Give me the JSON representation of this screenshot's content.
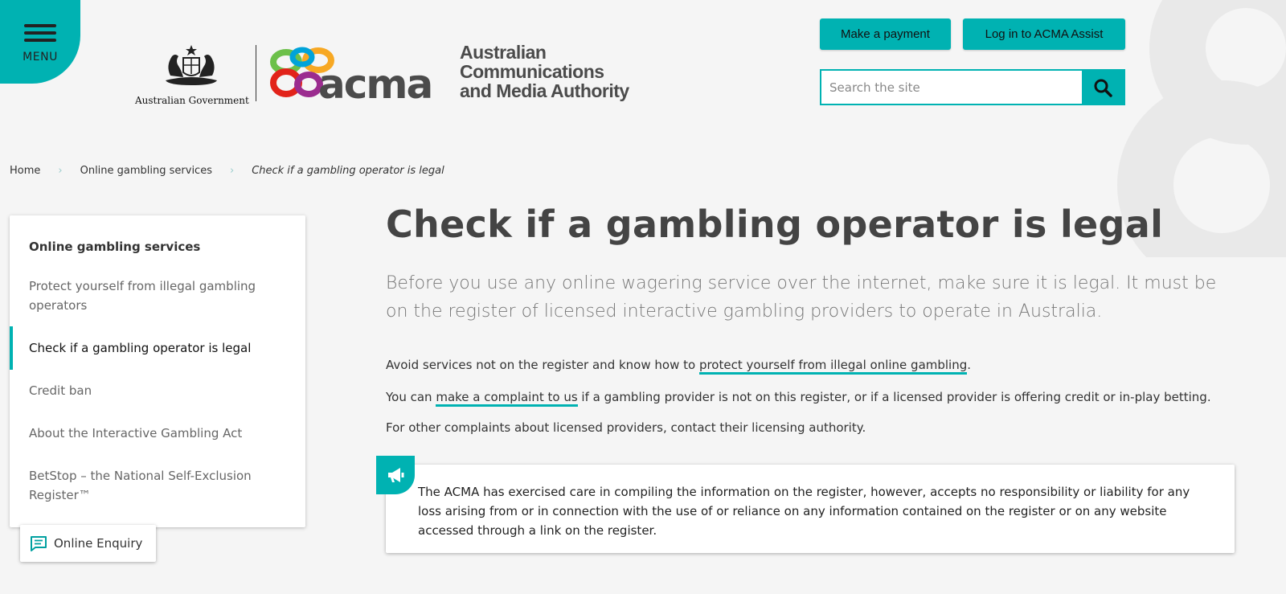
{
  "header": {
    "menu_label": "MENU",
    "gov_label": "Australian Government",
    "acma_word": "acma",
    "acma_name_lines": [
      "Australian",
      "Communications",
      "and Media Authority"
    ],
    "pay_label": "Make a payment",
    "login_label": "Log in to ACMA Assist",
    "search_placeholder": "Search the site"
  },
  "breadcrumb": {
    "home": "Home",
    "section": "Online gambling services",
    "current": "Check if a gambling operator is legal"
  },
  "sidebar": {
    "title": "Online gambling services",
    "items": [
      {
        "label": "Protect yourself from illegal gambling operators"
      },
      {
        "label": "Check if a gambling operator is legal"
      },
      {
        "label": "Credit ban"
      },
      {
        "label": "About the Interactive Gambling Act"
      },
      {
        "label": "BetStop – the National Self-Exclusion Register™"
      }
    ]
  },
  "enquiry_label": "Online Enquiry",
  "main": {
    "title": "Check if a gambling operator is legal",
    "lead": "Before you use any online wagering service over the internet, make sure it is legal. It must be on the register of licensed interactive gambling providers to operate in Australia.",
    "p1_before": "Avoid services not on the register and know how to ",
    "p1_link": "protect yourself from illegal online gambling",
    "p1_after": ".",
    "p2_before": "You can ",
    "p2_link": "make a complaint to us",
    "p2_after": " if a gambling provider is not on this register, or if a licensed provider is offering credit or in-play betting.",
    "p3": "For other complaints about licensed providers, contact their licensing authority.",
    "notice": "The ACMA has exercised care in compiling the information on the register, however, accepts no responsibility or liability for any loss arising from or in connection with the use of or reliance on any information contained on the register or on any website accessed through a link on the register."
  },
  "colors": {
    "accent": "#00b2b2",
    "background": "#f5f5f5"
  }
}
